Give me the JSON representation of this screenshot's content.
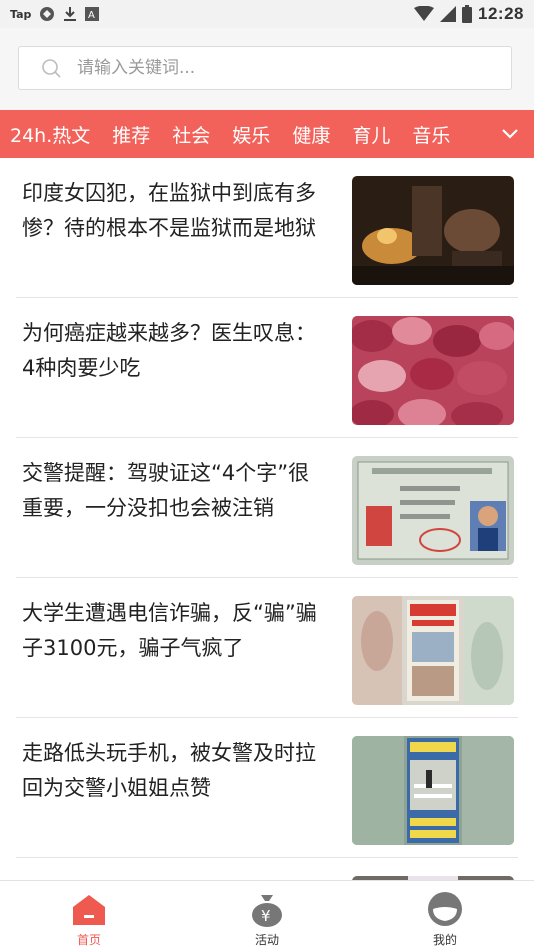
{
  "status_bar": {
    "carrier_label": "Tap",
    "time": "12:28"
  },
  "search": {
    "placeholder": "请输入关键词..."
  },
  "categories": [
    "24h.热文",
    "推荐",
    "社会",
    "娱乐",
    "健康",
    "育儿",
    "音乐"
  ],
  "articles": [
    {
      "title": "印度女囚犯，在监狱中到底有多惨？待的根本不是监狱而是地狱"
    },
    {
      "title": "为何癌症越来越多？医生叹息：4种肉要少吃"
    },
    {
      "title": "交警提醒：驾驶证这“4个字”很重要，一分没扣也会被注销"
    },
    {
      "title": "大学生遭遇电信诈骗，反“骗”骗子3100元，骗子气疯了"
    },
    {
      "title": "走路低头玩手机，被女警及时拉回为交警小姐姐点赞"
    }
  ],
  "tabs": [
    {
      "label": "首页",
      "icon": "home-icon",
      "active": true
    },
    {
      "label": "活动",
      "icon": "money-bag-icon",
      "active": false
    },
    {
      "label": "我的",
      "icon": "profile-icon",
      "active": false
    }
  ],
  "colors": {
    "accent": "#f2625a",
    "active_tab": "#ef5a50"
  }
}
